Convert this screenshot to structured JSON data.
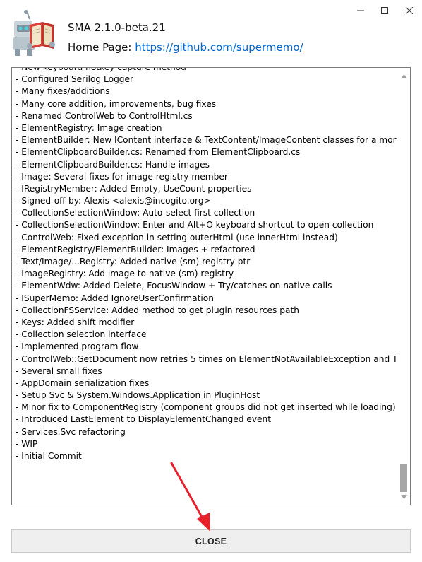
{
  "window": {
    "controls": {
      "minimize_icon": "minimize-icon",
      "maximize_icon": "maximize-icon",
      "close_icon": "close-icon"
    }
  },
  "header": {
    "app_title": "SMA 2.1.0-beta.21",
    "homepage_label": "Home Page: ",
    "homepage_link": "https://github.com/supermemo/",
    "logo_icon": "robot-reading-book-icon"
  },
  "changelog": {
    "lines": [
      "- New keyboard hotkey capture method",
      "- Configured Serilog Logger",
      "- Many fixes/additions",
      "- Many core addition, improvements, bug fixes",
      "- Renamed ControlWeb to ControlHtml.cs",
      "- ElementRegistry: Image creation",
      "- ElementBuilder: New IContent interface & TextContent/ImageContent classes for a more mod",
      "- ElementClipboardBuilder.cs: Renamed from ElementClipboard.cs",
      "- ElementClipboardBuilder.cs: Handle images",
      "- Image: Several fixes for image registry member",
      "- IRegistryMember: Added Empty, UseCount properties",
      "- Signed-off-by: Alexis <alexis@incogito.org>",
      "- CollectionSelectionWindow: Auto-select first collection",
      "- CollectionSelectionWindow: Enter and Alt+O keyboard shortcut to open collection",
      "- ControlWeb: Fixed exception in setting outerHtml (use innerHtml instead)",
      "- ElementRegistry/ElementBuilder: Images + refactored",
      "- Text/Image/...Registry: Added native (sm) registry ptr",
      "- ImageRegistry: Add image to native (sm) registry",
      "- ElementWdw: Added Delete, FocusWindow + Try/catches on native calls",
      "- ISuperMemo: Added IgnoreUserConfirmation",
      "- CollectionFSService: Added method to get plugin resources path",
      "- Keys: Added shift modifier",
      "- Collection selection interface",
      "- Implemented program flow",
      "- ControlWeb::GetDocument now retries 5 times on ElementNotAvailableException and TimeOu",
      "- Several small fixes",
      "- AppDomain serialization fixes",
      "- Setup Svc & System.Windows.Application in PluginHost",
      "- Minor fix to ComponentRegistry (component groups did not get inserted while loading)",
      "- Introduced LastElement to DisplayElementChanged event",
      "- Services.Svc refactoring",
      "- WIP",
      "- Initial Commit"
    ]
  },
  "scrollbar": {
    "up_icon": "scroll-up-arrow-icon",
    "down_icon": "scroll-down-arrow-icon",
    "position": 1.0
  },
  "footer": {
    "close_label": "CLOSE"
  },
  "annotation": {
    "arrow_color": "#e8202a",
    "arrow_icon": "red-pointer-arrow-icon"
  },
  "colors": {
    "link": "#0066cc",
    "button_bg": "#efefef",
    "border": "#7a7a7a"
  }
}
